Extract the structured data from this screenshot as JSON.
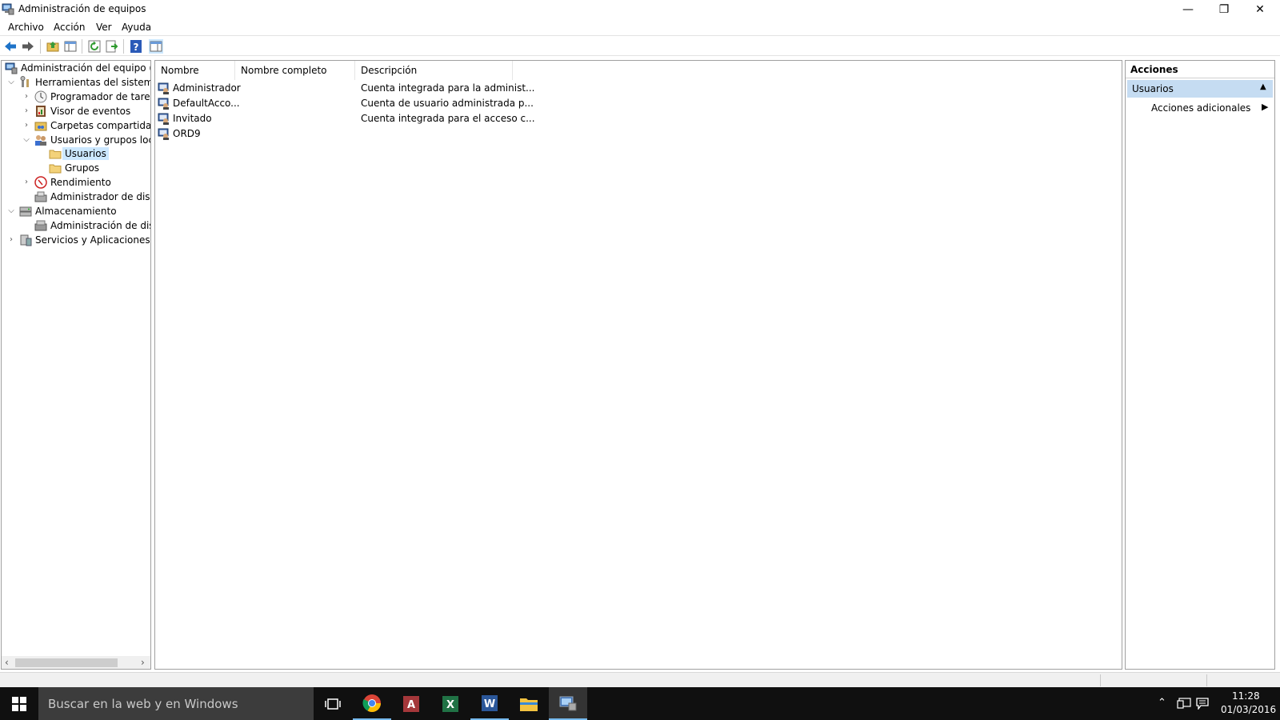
{
  "window": {
    "title": "Administración de equipos",
    "controls": {
      "minimize": "—",
      "restore": "❐",
      "close": "✕"
    }
  },
  "menu": [
    "Archivo",
    "Acción",
    "Ver",
    "Ayuda"
  ],
  "tree": {
    "items": [
      {
        "label": "Administración del equipo (loc",
        "icon": "computer-management-icon"
      },
      {
        "label": "Herramientas del sistema",
        "icon": "tools-icon"
      },
      {
        "label": "Programador de tareas",
        "icon": "clock-icon"
      },
      {
        "label": "Visor de eventos",
        "icon": "event-viewer-icon"
      },
      {
        "label": "Carpetas compartidas",
        "icon": "shared-folder-icon"
      },
      {
        "label": "Usuarios y grupos locale",
        "icon": "users-groups-icon"
      },
      {
        "label": "Usuarios",
        "icon": "folder-icon"
      },
      {
        "label": "Grupos",
        "icon": "folder-icon"
      },
      {
        "label": "Rendimiento",
        "icon": "performance-icon"
      },
      {
        "label": "Administrador de dispo",
        "icon": "device-manager-icon"
      },
      {
        "label": "Almacenamiento",
        "icon": "storage-icon"
      },
      {
        "label": "Administración de disco",
        "icon": "disk-icon"
      },
      {
        "label": "Servicios y Aplicaciones",
        "icon": "services-icon"
      }
    ]
  },
  "list": {
    "columns": [
      "Nombre",
      "Nombre completo",
      "Descripción"
    ],
    "rows": [
      {
        "name": "Administrador",
        "full_name": "",
        "description": "Cuenta integrada para la administ..."
      },
      {
        "name": "DefaultAcco...",
        "full_name": "",
        "description": "Cuenta de usuario administrada p..."
      },
      {
        "name": "Invitado",
        "full_name": "",
        "description": "Cuenta integrada para el acceso c..."
      },
      {
        "name": "ORD9",
        "full_name": "",
        "description": ""
      }
    ]
  },
  "actions": {
    "header": "Acciones",
    "section": "Usuarios",
    "more": "Acciones adicionales"
  },
  "taskbar": {
    "search_placeholder": "Buscar en la web y en Windows",
    "apps": [
      "task-view-icon",
      "chrome-icon",
      "access-icon",
      "excel-icon",
      "word-icon",
      "file-explorer-icon",
      "computer-management-icon"
    ],
    "time": "11:28",
    "date": "01/03/2016"
  },
  "colors": {
    "selection": "#cce8ff",
    "actions_section": "#c5dcf2",
    "taskbar": "#101010",
    "search_box": "#3c3c3c"
  }
}
